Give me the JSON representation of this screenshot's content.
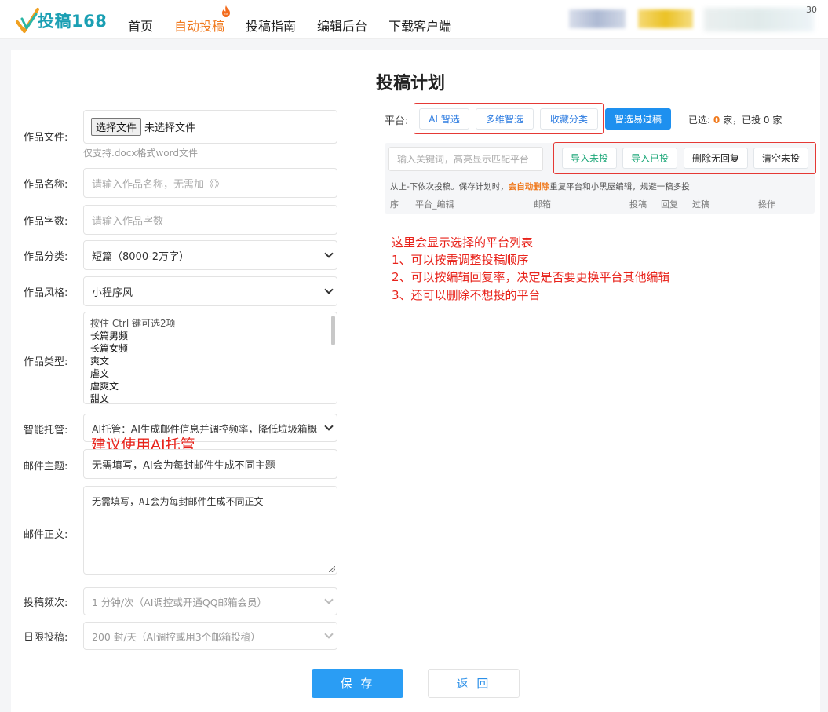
{
  "header": {
    "logo_text": "投稿168",
    "nav": [
      "首页",
      "自动投稿",
      "投稿指南",
      "编辑后台",
      "下载客户端"
    ],
    "active_index": 1,
    "hot_badge": "hot",
    "corner_text": "30",
    "accent": "#f07a1e"
  },
  "form": {
    "file": {
      "label": "作品文件:",
      "button": "选择文件",
      "status": "未选择文件",
      "hint": "仅支持.docx格式word文件"
    },
    "name": {
      "label": "作品名称:",
      "placeholder": "请输入作品名称，无需加《》"
    },
    "words": {
      "label": "作品字数:",
      "placeholder": "请输入作品字数"
    },
    "category": {
      "label": "作品分类:",
      "value": "短篇（8000-2万字）"
    },
    "style": {
      "label": "作品风格:",
      "value": "小程序风"
    },
    "type": {
      "label": "作品类型:",
      "hint": "按住 Ctrl 键可选2项",
      "options": [
        "长篇男频",
        "长篇女频",
        "爽文",
        "虐文",
        "虐爽文",
        "甜文"
      ]
    },
    "hosting": {
      "label": "智能托管:",
      "value": "AI托管：AI生成邮件信息并调控频率，降低垃圾箱概"
    },
    "suggestion": "建议使用AI托管",
    "subject": {
      "label": "邮件主题:",
      "value": "无需填写，AI会为每封邮件生成不同主题"
    },
    "body": {
      "label": "邮件正文:",
      "value": "无需填写，AI会为每封邮件生成不同正文"
    },
    "frequency": {
      "label": "投稿频次:",
      "value": "1 分钟/次（AI调控或开通QQ邮箱会员）"
    },
    "daily_limit": {
      "label": "日限投稿:",
      "value": "200 封/天（AI调控或用3个邮箱投稿）"
    }
  },
  "plan": {
    "title": "投稿计划",
    "platform_label": "平台:",
    "platform_buttons": [
      "AI 智选",
      "多维智选",
      "收藏分类"
    ],
    "filter_button": "智选易过稿",
    "selected_prefix": "已选:",
    "selected_count": "0",
    "selected_suffix": "家，已投 0 家",
    "search_placeholder": "输入关键词，高亮显示匹配平台",
    "actions": [
      "导入未投",
      "导入已投",
      "删除无回复",
      "清空未投"
    ],
    "notice_pre": "从上-下依次投稿。保存计划时，",
    "notice_em": "会自动删除",
    "notice_post": "重复平台和小黑屋编辑，规避一稿多投",
    "columns": [
      "序",
      "平台_编辑",
      "邮箱",
      "投稿",
      "回复",
      "过稿",
      "操作"
    ],
    "annotations": [
      "这里会显示选择的平台列表",
      "1、可以按需调整投稿顺序",
      "2、可以按编辑回复率，决定是否要更换平台其他编辑",
      "3、还可以删除不想投的平台"
    ]
  },
  "footer": {
    "save": "保 存",
    "back": "返 回"
  }
}
